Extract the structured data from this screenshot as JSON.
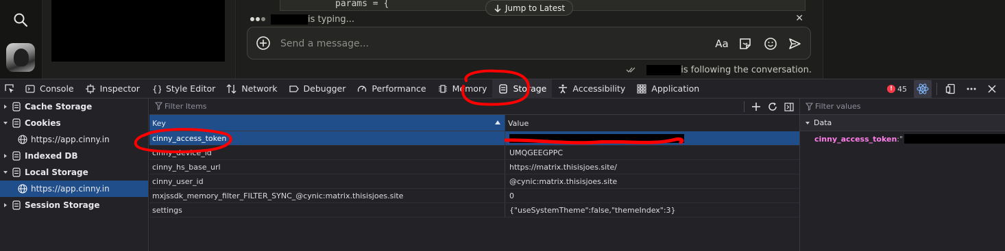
{
  "app": {
    "code_snippet": "params = {",
    "jump_label": "Jump to Latest",
    "typing_suffix": "is typing...",
    "composer_placeholder": "Send a message...",
    "composer_font_label": "Aa",
    "following_suffix": "is following the conversation."
  },
  "toolbar": {
    "tabs": [
      {
        "label": "Console",
        "icon": "console-icon"
      },
      {
        "label": "Inspector",
        "icon": "inspector-icon"
      },
      {
        "label": "Style Editor",
        "icon": "style-editor-icon"
      },
      {
        "label": "Network",
        "icon": "network-icon"
      },
      {
        "label": "Debugger",
        "icon": "debugger-icon"
      },
      {
        "label": "Performance",
        "icon": "performance-icon"
      },
      {
        "label": "Memory",
        "icon": "memory-icon"
      },
      {
        "label": "Storage",
        "icon": "storage-icon",
        "selected": true
      },
      {
        "label": "Accessibility",
        "icon": "accessibility-icon"
      },
      {
        "label": "Application",
        "icon": "application-icon"
      }
    ],
    "error_count": "45"
  },
  "sidebar": {
    "items": [
      {
        "label": "Cache Storage"
      },
      {
        "label": "Cookies"
      },
      {
        "label": "https://app.cinny.in"
      },
      {
        "label": "Indexed DB"
      },
      {
        "label": "Local Storage"
      },
      {
        "label": "https://app.cinny.in"
      },
      {
        "label": "Session Storage"
      }
    ]
  },
  "table": {
    "filter_placeholder": "Filter Items",
    "columns": {
      "key": "Key",
      "value": "Value"
    },
    "rows": [
      {
        "key": "cinny_access_token",
        "value": ""
      },
      {
        "key": "cinny_device_id",
        "value": "UMQGEEGPPC"
      },
      {
        "key": "cinny_hs_base_url",
        "value": "https://matrix.thisisjoes.site/"
      },
      {
        "key": "cinny_user_id",
        "value": "@cynic:matrix.thisisjoes.site"
      },
      {
        "key": "mxjssdk_memory_filter_FILTER_SYNC_@cynic:matrix.thisisjoes.site",
        "value": "0"
      },
      {
        "key": "settings",
        "value": "{\"useSystemTheme\":false,\"themeIndex\":3}"
      }
    ]
  },
  "data_panel": {
    "filter_placeholder": "Filter values",
    "section_label": "Data",
    "entry_key": "cinny_access_token",
    "entry_sep": ":\""
  },
  "colors": {
    "selection": "#204e8a",
    "annotation": "#ff0000",
    "entry_key": "#ff7de9"
  }
}
